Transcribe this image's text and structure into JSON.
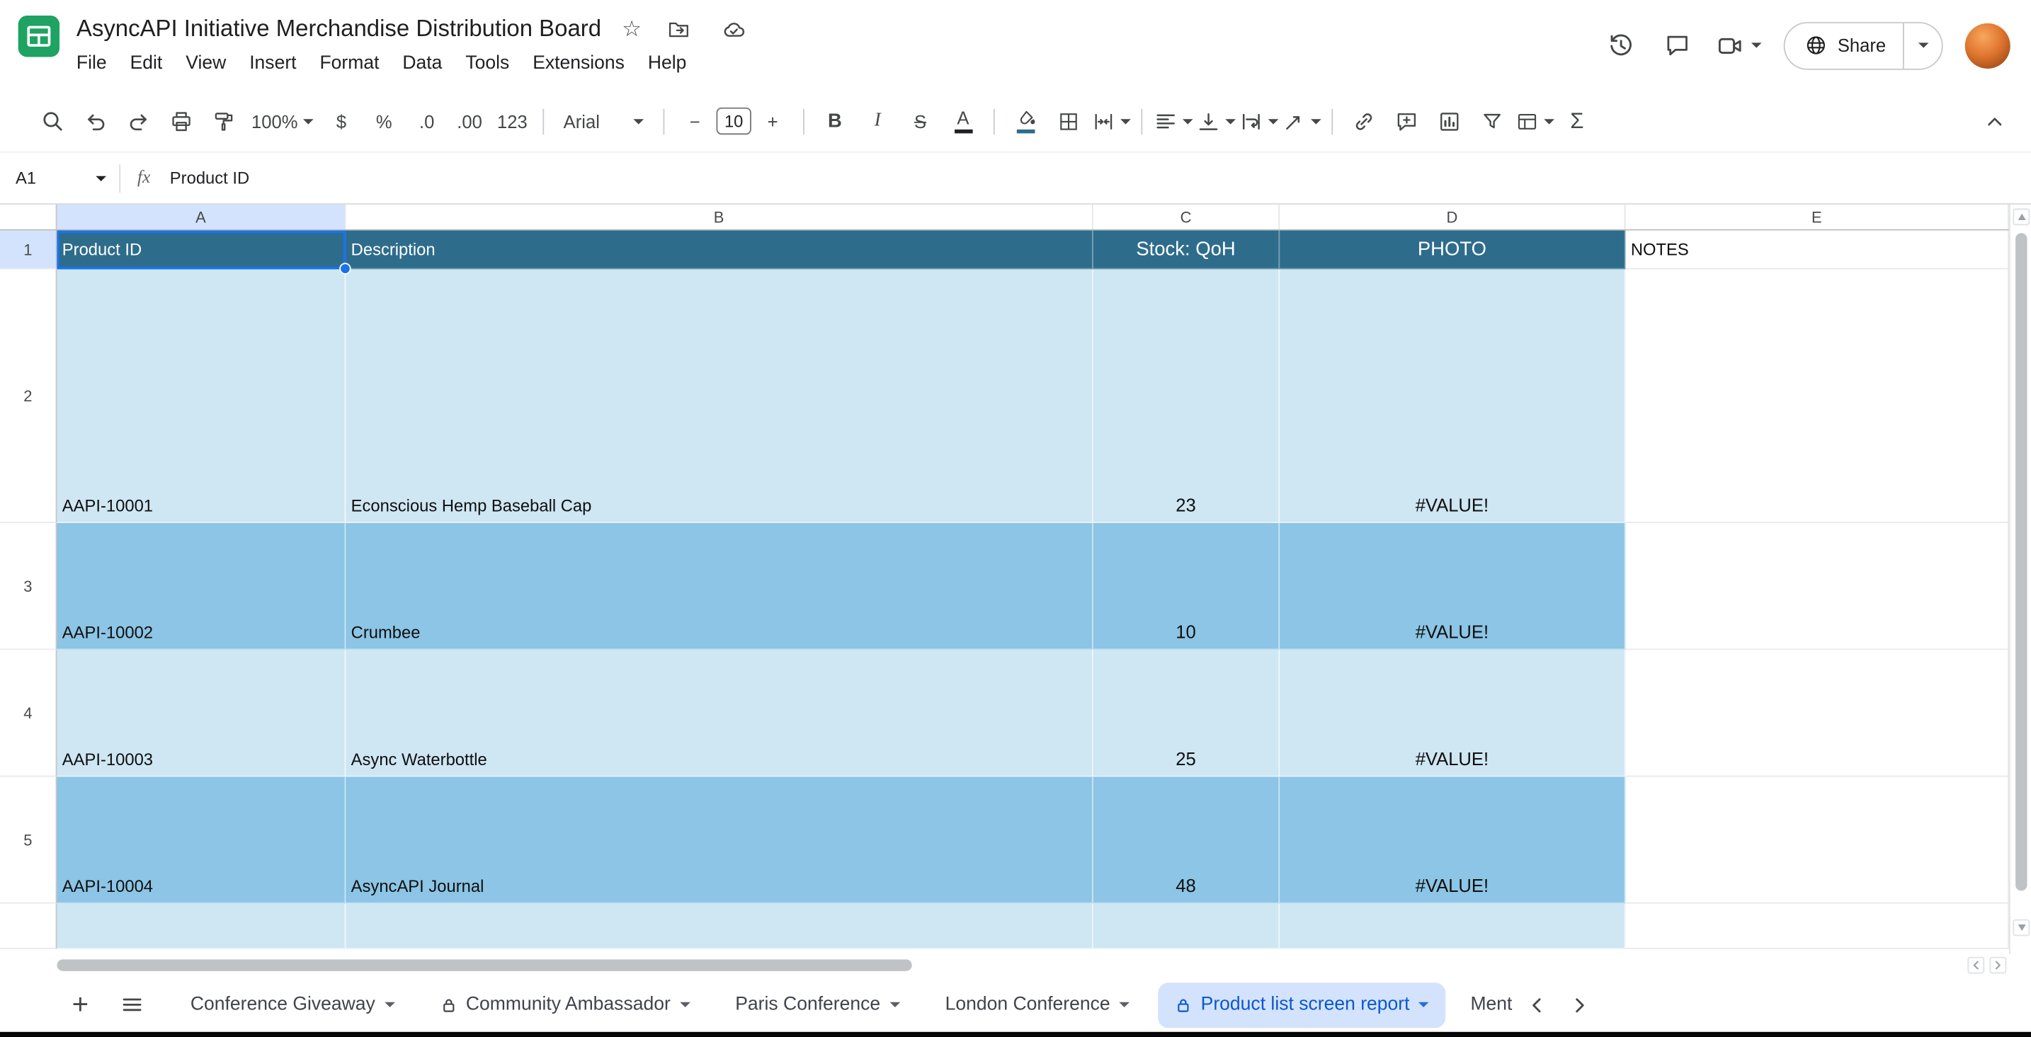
{
  "header": {
    "title": "AsyncAPI Initiative Merchandise Distribution Board",
    "star": "☆",
    "menus": [
      "File",
      "Edit",
      "View",
      "Insert",
      "Format",
      "Data",
      "Tools",
      "Extensions",
      "Help"
    ],
    "share_label": "Share"
  },
  "toolbar": {
    "zoom": "100%",
    "currency": "$",
    "percent": "%",
    "decimal_decrease": ".0",
    "decimal_increase": ".00",
    "more_formats": "123",
    "font_name": "Arial",
    "minus": "−",
    "font_size": "10",
    "plus": "+",
    "bold": "B",
    "italic": "I",
    "strikethrough": "S",
    "text_color": "A",
    "functions": "Σ"
  },
  "formula_bar": {
    "cell_reference": "A1",
    "fx_label": "fx",
    "value": "Product ID"
  },
  "grid": {
    "column_headers": [
      "A",
      "B",
      "C",
      "D",
      "E"
    ],
    "row_headers": [
      "1",
      "2",
      "3",
      "4",
      "5"
    ],
    "rows": [
      [
        "Product ID",
        "Description",
        "Stock: QoH",
        "PHOTO",
        "NOTES"
      ],
      [
        "AAPI-10001",
        "Econscious Hemp Baseball Cap",
        "23",
        "#VALUE!",
        ""
      ],
      [
        "AAPI-10002",
        "Crumbee",
        "10",
        "#VALUE!",
        ""
      ],
      [
        "AAPI-10003",
        "Async Waterbottle",
        "25",
        "#VALUE!",
        ""
      ],
      [
        "AAPI-10004",
        "AsyncAPI Journal",
        "48",
        "#VALUE!",
        ""
      ],
      [
        "",
        "",
        "",
        "",
        ""
      ]
    ]
  },
  "sheet_tabs": {
    "add": "+",
    "items": [
      {
        "label": "Conference Giveaway"
      },
      {
        "label": "Community Ambassador"
      },
      {
        "label": "Paris Conference"
      },
      {
        "label": "London Conference"
      },
      {
        "label": "Product list screen report"
      },
      {
        "label": "Ment"
      }
    ]
  },
  "colors": {
    "header_fill": "#2e6c8c",
    "band_light": "#cfe6f3",
    "band_mid": "#8cc5e5",
    "accent": "#1a73e8",
    "active_tab_bg": "#d3e3fd",
    "active_tab_text": "#0b57d0",
    "logo_green": "#1ea362"
  }
}
